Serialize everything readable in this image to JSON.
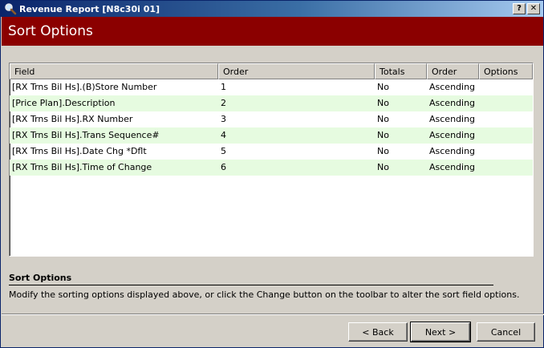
{
  "window": {
    "title": "Revenue Report [N8c30i 01]",
    "help_label": "?",
    "close_label": "✕"
  },
  "header": {
    "title": "Sort Options"
  },
  "grid": {
    "columns": [
      "Field",
      "Order",
      "Totals",
      "Order",
      "Options"
    ],
    "rows": [
      {
        "field": "[RX Trns Bil Hs].(B)Store Number",
        "order": "1",
        "totals": "No",
        "direction": "Ascending",
        "options": ""
      },
      {
        "field": "[Price Plan].Description",
        "order": "2",
        "totals": "No",
        "direction": "Ascending",
        "options": ""
      },
      {
        "field": "[RX Trns Bil Hs].RX Number",
        "order": "3",
        "totals": "No",
        "direction": "Ascending",
        "options": ""
      },
      {
        "field": "[RX Trns Bil Hs].Trans Sequence#",
        "order": "4",
        "totals": "No",
        "direction": "Ascending",
        "options": ""
      },
      {
        "field": "[RX Trns Bil Hs].Date Chg *Dflt",
        "order": "5",
        "totals": "No",
        "direction": "Ascending",
        "options": ""
      },
      {
        "field": "[RX Trns Bil Hs].Time of Change",
        "order": "6",
        "totals": "No",
        "direction": "Ascending",
        "options": ""
      }
    ],
    "alt_row_color": "#e6fbe0"
  },
  "description": {
    "title": "Sort Options",
    "text": "Modify the sorting options displayed above, or click the Change button on the toolbar to alter the sort field options."
  },
  "buttons": {
    "back": "< Back",
    "next": "Next >",
    "cancel": "Cancel"
  },
  "colors": {
    "header_band": "#8b0000",
    "titlebar_start": "#0a246a",
    "titlebar_end": "#a6caf0"
  },
  "icons": {
    "title": "magnifier-icon"
  }
}
